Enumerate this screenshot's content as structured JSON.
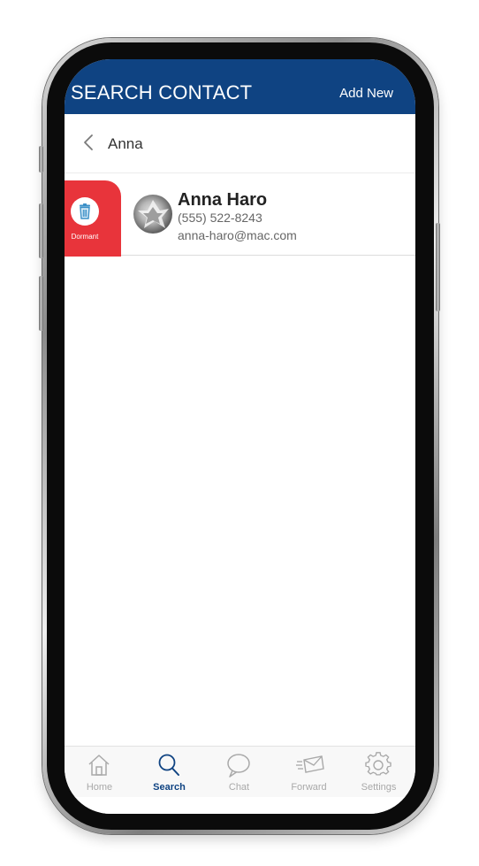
{
  "header": {
    "title": "SEARCH CONTACT",
    "action_label": "Add New",
    "background_color": "#0f4382"
  },
  "search": {
    "value": "Anna",
    "back_icon": "chevron-left-icon"
  },
  "swipe_action": {
    "label": "Dormant",
    "icon": "trash-icon",
    "color": "#e8343b"
  },
  "results": [
    {
      "name": "Anna Haro",
      "phone": "(555) 522-8243",
      "email": "anna-haro@mac.com"
    }
  ],
  "tab_bar": {
    "active_tab": "Search",
    "active_color": "#0f4382",
    "tabs": [
      {
        "label": "Home",
        "icon": "home-icon"
      },
      {
        "label": "Search",
        "icon": "search-icon"
      },
      {
        "label": "Chat",
        "icon": "chat-bubble-icon"
      },
      {
        "label": "Forward",
        "icon": "forward-mail-icon"
      },
      {
        "label": "Settings",
        "icon": "gear-icon"
      }
    ]
  }
}
